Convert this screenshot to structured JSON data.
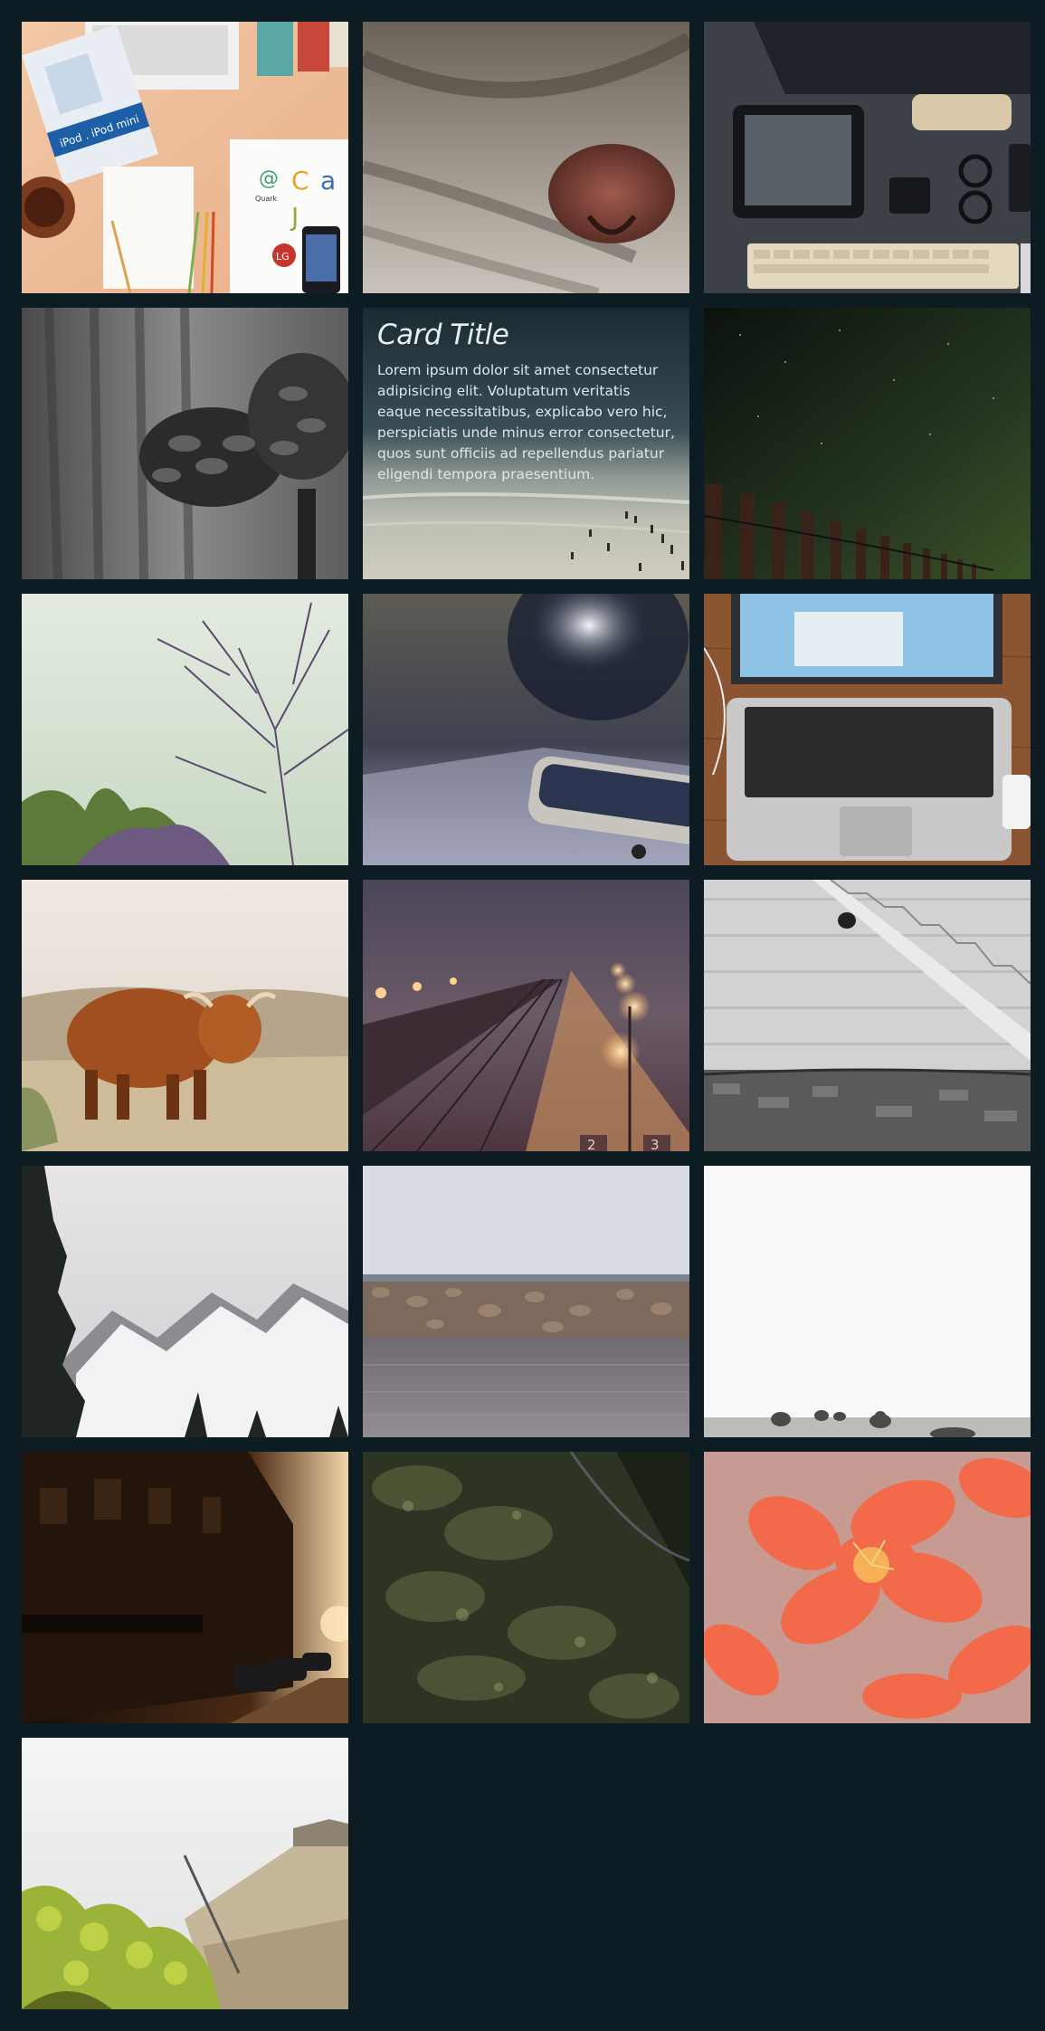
{
  "card": {
    "title": "Card Title",
    "body": "Lorem ipsum dolor sit amet consectetur adipisicing elit. Voluptatum veritatis eaque necessitatibus, explicabo vero hic, perspiciatis unde minus error consectetur, quos sunt officiis ad repellendus pariatur eligendi tempora praesentium."
  },
  "tiles": [
    {
      "name": "desk-flatlay-photo",
      "ipod_label": "iPod . iPod mini",
      "brand_texts": [
        "Quark",
        "C",
        "a",
        "J",
        "LG"
      ]
    },
    {
      "name": "cat-nose-photo"
    },
    {
      "name": "tablet-desk-photo"
    },
    {
      "name": "pinecone-photo"
    },
    {
      "name": "card-beach-tile"
    },
    {
      "name": "night-sky-fence-photo"
    },
    {
      "name": "bare-tree-photo"
    },
    {
      "name": "phone-bokeh-photo"
    },
    {
      "name": "laptop-wood-desk-photo"
    },
    {
      "name": "highland-cow-photo"
    },
    {
      "name": "foggy-train-station-photo",
      "platform_numbers": [
        "2",
        "3"
      ]
    },
    {
      "name": "stone-stairs-photo"
    },
    {
      "name": "snowy-mountain-photo"
    },
    {
      "name": "rock-breakwater-photo"
    },
    {
      "name": "white-field-hay-photo"
    },
    {
      "name": "sunset-street-photo"
    },
    {
      "name": "mossy-bark-photo"
    },
    {
      "name": "orange-flowers-photo"
    },
    {
      "name": "boat-foliage-photo"
    }
  ],
  "colors": {
    "background": "#0d1b22",
    "card_text": "#e9eef2"
  }
}
